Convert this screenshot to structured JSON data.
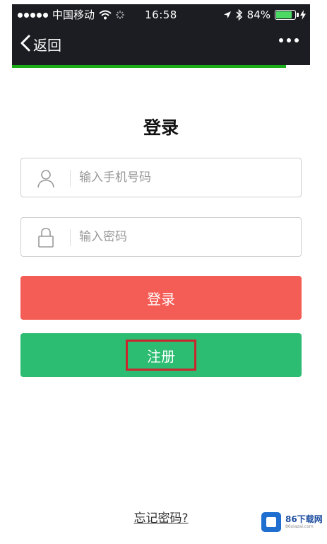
{
  "status_bar": {
    "carrier": "中国移动",
    "time": "16:58",
    "battery_text": "84%",
    "battery_level": 0.84
  },
  "nav": {
    "back_label": "返回"
  },
  "page": {
    "title": "登录",
    "progress_fraction": 0.92
  },
  "form": {
    "phone_placeholder": "输入手机号码",
    "password_placeholder": "输入密码",
    "login_label": "登录",
    "register_label": "注册",
    "forgot_label": "忘记密码?"
  },
  "watermark": {
    "name": "86下载网",
    "domain": "86xiazai.com"
  },
  "colors": {
    "login_button": "#f45d55",
    "register_button": "#2cbc72",
    "highlight_border": "#c8272d",
    "progress": "#1aad19"
  },
  "icons": [
    "wifi-icon",
    "loading-icon",
    "location-icon",
    "bluetooth-icon",
    "battery-icon",
    "charging-icon",
    "chevron-left-icon",
    "more-icon",
    "user-icon",
    "lock-icon"
  ]
}
